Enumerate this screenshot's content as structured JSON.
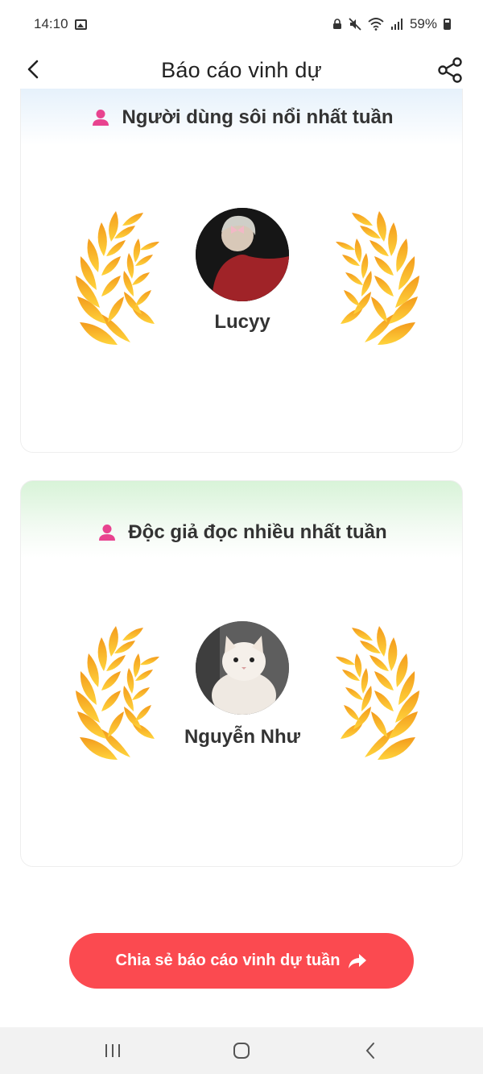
{
  "status_bar": {
    "time": "14:10",
    "battery": "59%"
  },
  "header": {
    "title": "Báo cáo vinh dự",
    "back_icon": "chevron-left-icon",
    "share_icon": "share-icon"
  },
  "cards": [
    {
      "title": "Người dùng sôi nổi nhất tuần",
      "icon": "user-icon",
      "winner": "Lucyy",
      "avatar_desc": "person-avatar"
    },
    {
      "title": "Độc giả đọc nhiều nhất tuần",
      "icon": "user-icon",
      "winner": "Nguyễn Như",
      "avatar_desc": "cat-avatar"
    }
  ],
  "share_button": {
    "label": "Chia sẻ báo cáo vinh dự tuần",
    "icon": "forward-arrow-icon"
  },
  "colors": {
    "accent": "#fb4a50",
    "icon_pink": "#e8438f",
    "laurel_gold": "#f7a21b",
    "laurel_yellow": "#ffd23f"
  }
}
